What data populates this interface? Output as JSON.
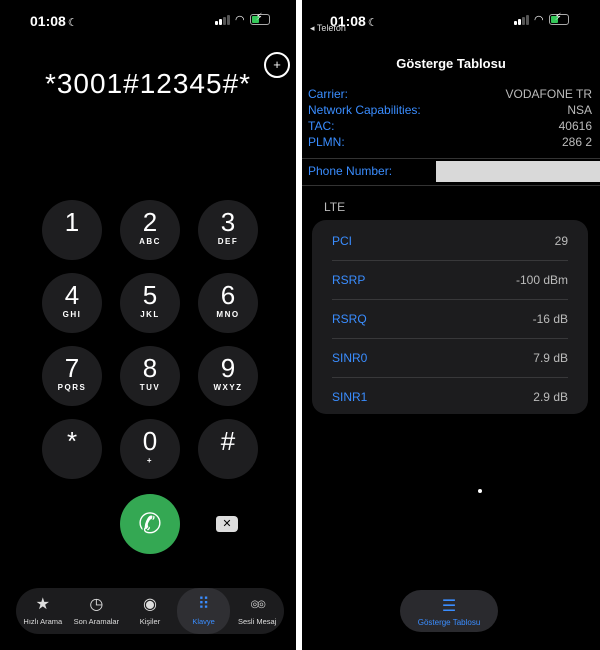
{
  "left": {
    "status": {
      "time": "01:08"
    },
    "dialed_number": "*3001#12345#*",
    "keys": [
      {
        "digit": "1",
        "letters": ""
      },
      {
        "digit": "2",
        "letters": "ABC"
      },
      {
        "digit": "3",
        "letters": "DEF"
      },
      {
        "digit": "4",
        "letters": "GHI"
      },
      {
        "digit": "5",
        "letters": "JKL"
      },
      {
        "digit": "6",
        "letters": "MNO"
      },
      {
        "digit": "7",
        "letters": "PQRS"
      },
      {
        "digit": "8",
        "letters": "TUV"
      },
      {
        "digit": "9",
        "letters": "WXYZ"
      },
      {
        "digit": "*",
        "letters": ""
      },
      {
        "digit": "0",
        "letters": "+"
      },
      {
        "digit": "#",
        "letters": ""
      }
    ],
    "tabs": [
      {
        "label": "Hızlı Arama",
        "icon": "star-icon"
      },
      {
        "label": "Son Aramalar",
        "icon": "clock-icon"
      },
      {
        "label": "Kişiler",
        "icon": "person-icon"
      },
      {
        "label": "Klavye",
        "icon": "keypad-icon"
      },
      {
        "label": "Sesli Mesaj",
        "icon": "voicemail-icon"
      }
    ],
    "active_tab": "Klavye"
  },
  "right": {
    "status": {
      "time": "01:08",
      "back_label": "◂ Telefon"
    },
    "title": "Gösterge Tablosu",
    "info": [
      {
        "key": "Carrier:",
        "value": "VODAFONE TR"
      },
      {
        "key": "Network Capabilities:",
        "value": "NSA"
      },
      {
        "key": "TAC:",
        "value": "40616"
      },
      {
        "key": "PLMN:",
        "value": "286 2"
      }
    ],
    "phone_number_label": "Phone Number:",
    "lte_header": "LTE",
    "lte": [
      {
        "key": "PCI",
        "value": "29"
      },
      {
        "key": "RSRP",
        "value": "-100 dBm"
      },
      {
        "key": "RSRQ",
        "value": "-16 dB"
      },
      {
        "key": "SINR0",
        "value": "7.9 dB"
      },
      {
        "key": "SINR1",
        "value": "2.9 dB"
      }
    ],
    "tab_label": "Gösterge Tablosu"
  },
  "colors": {
    "accent": "#3a8dff",
    "call": "#34a853",
    "key_bg": "#1e1e20"
  }
}
